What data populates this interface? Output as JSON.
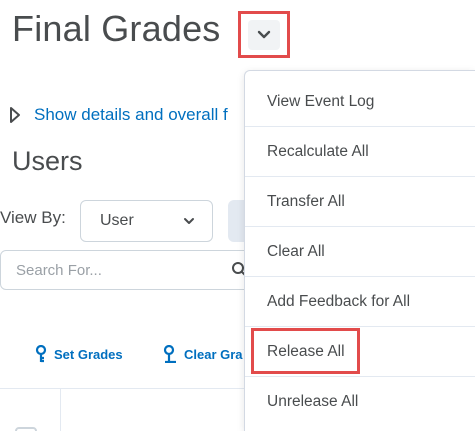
{
  "page": {
    "title": "Final Grades",
    "details_link": "Show details and overall f",
    "users_heading": "Users",
    "view_by_label": "View By:",
    "view_by_value": "User",
    "search_placeholder": "Search For..."
  },
  "actions": {
    "set_grades": "Set Grades",
    "clear_grades": "Clear Gra"
  },
  "menu": {
    "items": [
      "View Event Log",
      "Recalculate All",
      "Transfer All",
      "Clear All",
      "Add Feedback for All",
      "Release All",
      "Unrelease All"
    ],
    "highlighted_item": "Release All"
  },
  "colors": {
    "link": "#006fbf",
    "highlight_border": "#e24b4b",
    "text": "#494c4e"
  },
  "icons": {
    "title_toggle": "chevron-down-icon",
    "details": "caret-right-icon",
    "search": "search-icon",
    "set_grades": "key-icon",
    "clear_grades": "key-clear-icon"
  }
}
